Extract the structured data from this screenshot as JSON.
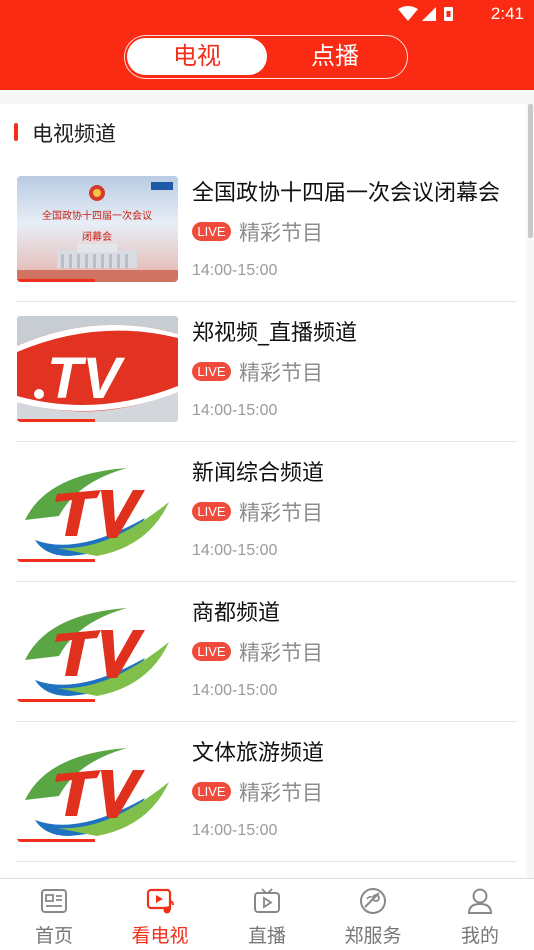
{
  "status_bar": {
    "time": "2:41"
  },
  "tabs": [
    {
      "label": "电视"
    },
    {
      "label": "点播"
    }
  ],
  "section": {
    "title": "电视频道"
  },
  "channels": [
    {
      "name": "全国政协十四届一次会议闭幕会",
      "badge": "LIVE",
      "program": "精彩节目",
      "time": "14:00-15:00",
      "thumb_text_1": "全国政协十四届一次会议",
      "thumb_text_2": "闭幕会"
    },
    {
      "name": "郑视频_直播频道",
      "badge": "LIVE",
      "program": "精彩节目",
      "time": "14:00-15:00"
    },
    {
      "name": "新闻综合频道",
      "badge": "LIVE",
      "program": "精彩节目",
      "time": "14:00-15:00"
    },
    {
      "name": "商都频道",
      "badge": "LIVE",
      "program": "精彩节目",
      "time": "14:00-15:00"
    },
    {
      "name": "文体旅游频道",
      "badge": "LIVE",
      "program": "精彩节目",
      "time": "14:00-15:00"
    }
  ],
  "bottom_nav": [
    {
      "label": "首页",
      "icon": "news-icon",
      "active": false
    },
    {
      "label": "看电视",
      "icon": "tv-play-icon",
      "active": true
    },
    {
      "label": "直播",
      "icon": "live-tv-icon",
      "active": false
    },
    {
      "label": "郑服务",
      "icon": "service-icon",
      "active": false
    },
    {
      "label": "我的",
      "icon": "user-icon",
      "active": false
    }
  ],
  "colors": {
    "brand_red": "#fb2a12",
    "accent_red": "#f12f1a",
    "live_badge": "#f04b3a"
  }
}
